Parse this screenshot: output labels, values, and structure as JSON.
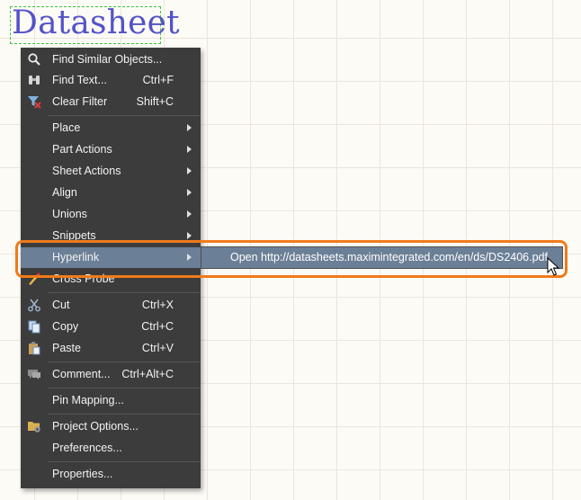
{
  "canvas": {
    "title": "Datasheet",
    "accent_color": "#5353c8",
    "selection_color": "#3ec43e"
  },
  "context_menu": {
    "items": [
      {
        "label": "Find Similar Objects...",
        "shortcut": "",
        "icon": "search-icon"
      },
      {
        "label": "Find Text...",
        "shortcut": "Ctrl+F",
        "icon": "binoculars-icon"
      },
      {
        "label": "Clear Filter",
        "shortcut": "Shift+C",
        "icon": "clear-filter-icon"
      },
      {
        "label": "Place",
        "submenu": true
      },
      {
        "label": "Part Actions",
        "submenu": true
      },
      {
        "label": "Sheet Actions",
        "submenu": true
      },
      {
        "label": "Align",
        "submenu": true
      },
      {
        "label": "Unions",
        "submenu": true
      },
      {
        "label": "Snippets",
        "submenu": true
      },
      {
        "label": "Hyperlink",
        "submenu": true,
        "highlighted": true
      },
      {
        "label": "Cross Probe",
        "icon": "cross-probe-icon"
      },
      {
        "label": "Cut",
        "shortcut": "Ctrl+X",
        "icon": "scissors-icon"
      },
      {
        "label": "Copy",
        "shortcut": "Ctrl+C",
        "icon": "copy-icon"
      },
      {
        "label": "Paste",
        "shortcut": "Ctrl+V",
        "icon": "paste-icon"
      },
      {
        "label": "Comment...",
        "shortcut": "Ctrl+Alt+C",
        "icon": "comment-icon"
      },
      {
        "label": "Pin Mapping..."
      },
      {
        "label": "Project Options...",
        "icon": "project-options-icon"
      },
      {
        "label": "Preferences..."
      },
      {
        "label": "Properties..."
      }
    ]
  },
  "submenu": {
    "item_label": "Open http://datasheets.maximintegrated.com/en/ds/DS2406.pdf"
  },
  "colors": {
    "menu_bg": "#3c3c3c",
    "highlight": "#6b7f97",
    "callout": "#f07b1a"
  }
}
